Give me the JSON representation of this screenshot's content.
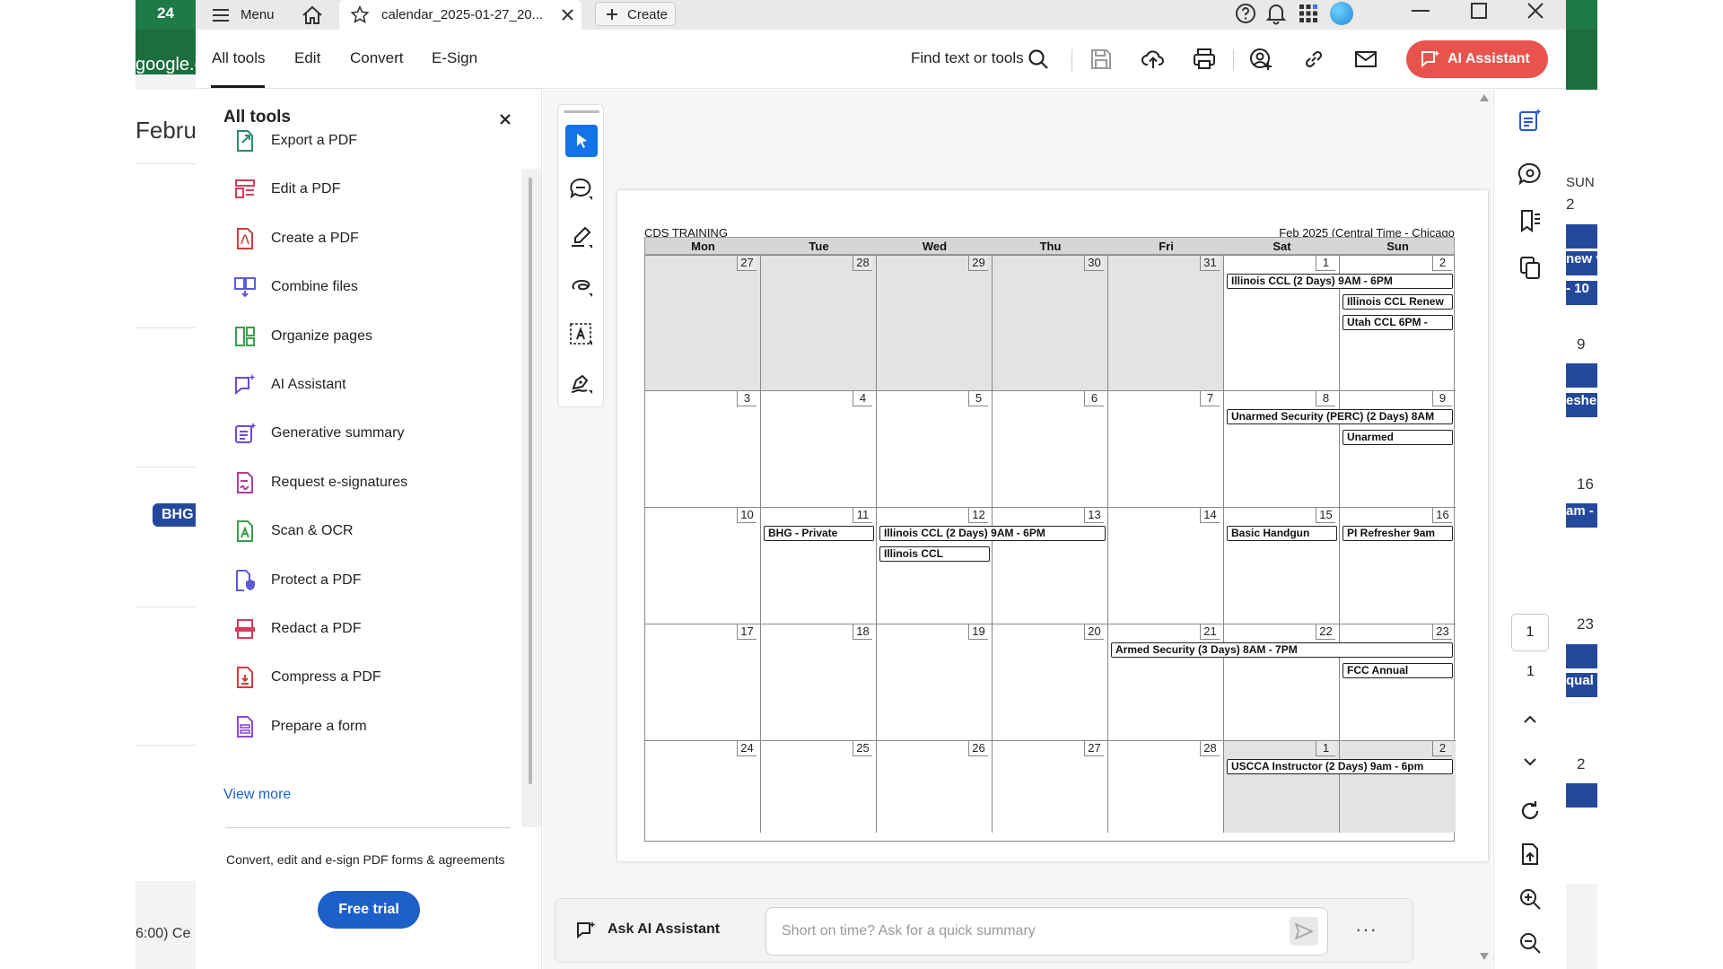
{
  "background": {
    "left_badge": "24",
    "left_domain": "google.c",
    "left_month": "Februa",
    "left_event": "BHG",
    "left_timezone": "6:00) Ce",
    "right_day_label": "SUN",
    "right_numbers": [
      "2",
      "9",
      "16",
      "23",
      "2"
    ],
    "right_events": [
      "new v",
      "- 10",
      "esher",
      "am -",
      "qual"
    ]
  },
  "titlebar": {
    "menu_label": "Menu",
    "tab_title": "calendar_2025-01-27_20...",
    "create_label": "Create"
  },
  "toolbar": {
    "tabs": [
      "All tools",
      "Edit",
      "Convert",
      "E-Sign"
    ],
    "search_label": "Find text or tools",
    "ai_assistant_label": "AI Assistant"
  },
  "sidebar": {
    "title": "All tools",
    "items": [
      {
        "label": "Export a PDF",
        "icon": "export-pdf-icon",
        "color": "#2e8b6e"
      },
      {
        "label": "Edit a PDF",
        "icon": "edit-pdf-icon",
        "color": "#d53c5c"
      },
      {
        "label": "Create a PDF",
        "icon": "create-pdf-icon",
        "color": "#d53c3c"
      },
      {
        "label": "Combine files",
        "icon": "combine-files-icon",
        "color": "#5b5bd6"
      },
      {
        "label": "Organize pages",
        "icon": "organize-pages-icon",
        "color": "#3aa04a"
      },
      {
        "label": "AI Assistant",
        "icon": "ai-assistant-icon",
        "color": "#6c4ad6"
      },
      {
        "label": "Generative summary",
        "icon": "generative-summary-icon",
        "color": "#6c4ad6"
      },
      {
        "label": "Request e-signatures",
        "icon": "request-esignatures-icon",
        "color": "#b0409a"
      },
      {
        "label": "Scan & OCR",
        "icon": "scan-ocr-icon",
        "color": "#3aa04a"
      },
      {
        "label": "Protect a PDF",
        "icon": "protect-pdf-icon",
        "color": "#5b5bd6"
      },
      {
        "label": "Redact a PDF",
        "icon": "redact-pdf-icon",
        "color": "#d53c5c"
      },
      {
        "label": "Compress a PDF",
        "icon": "compress-pdf-icon",
        "color": "#d53c3c"
      },
      {
        "label": "Prepare a form",
        "icon": "prepare-form-icon",
        "color": "#8b4ad6"
      }
    ],
    "view_more": "View more",
    "promo_text": "Convert, edit and e-sign PDF forms & agreements",
    "free_trial": "Free trial"
  },
  "calendar": {
    "title": "CDS TRAINING",
    "subtitle": "Feb 2025 (Central Time - Chicago",
    "days": [
      "Mon",
      "Tue",
      "Wed",
      "Thu",
      "Fri",
      "Sat",
      "Sun"
    ],
    "weeks": [
      {
        "dates": [
          "27",
          "28",
          "29",
          "30",
          "31",
          "1",
          "2"
        ],
        "gray": [
          true,
          true,
          true,
          true,
          true,
          false,
          false
        ]
      },
      {
        "dates": [
          "3",
          "4",
          "5",
          "6",
          "7",
          "8",
          "9"
        ],
        "gray": [
          false,
          false,
          false,
          false,
          false,
          false,
          false
        ]
      },
      {
        "dates": [
          "10",
          "11",
          "12",
          "13",
          "14",
          "15",
          "16"
        ],
        "gray": [
          false,
          false,
          false,
          false,
          false,
          false,
          false
        ]
      },
      {
        "dates": [
          "17",
          "18",
          "19",
          "20",
          "21",
          "22",
          "23"
        ],
        "gray": [
          false,
          false,
          false,
          false,
          false,
          false,
          false
        ]
      },
      {
        "dates": [
          "24",
          "25",
          "26",
          "27",
          "28",
          "1",
          "2"
        ],
        "gray": [
          false,
          false,
          false,
          false,
          false,
          true,
          true
        ]
      }
    ],
    "events": [
      {
        "week": 0,
        "col": 5,
        "span": 2,
        "row": 0,
        "label": "Illinois CCL (2 Days) 9AM - 6PM"
      },
      {
        "week": 0,
        "col": 6,
        "span": 1,
        "row": 1,
        "label": "Illinois CCL Renew"
      },
      {
        "week": 0,
        "col": 6,
        "span": 1,
        "row": 2,
        "label": "Utah CCL 6PM -"
      },
      {
        "week": 1,
        "col": 5,
        "span": 2,
        "row": 0,
        "label": "Unarmed Security (PERC) (2 Days) 8AM"
      },
      {
        "week": 1,
        "col": 6,
        "span": 1,
        "row": 1,
        "label": "Unarmed"
      },
      {
        "week": 2,
        "col": 1,
        "span": 1,
        "row": 0,
        "label": "BHG - Private"
      },
      {
        "week": 2,
        "col": 2,
        "span": 2,
        "row": 0,
        "label": "Illinois CCL (2 Days) 9AM - 6PM"
      },
      {
        "week": 2,
        "col": 2,
        "span": 1,
        "row": 1,
        "label": "Illinois CCL"
      },
      {
        "week": 2,
        "col": 5,
        "span": 1,
        "row": 0,
        "label": "Basic Handgun"
      },
      {
        "week": 2,
        "col": 6,
        "span": 1,
        "row": 0,
        "label": "PI Refresher 9am"
      },
      {
        "week": 3,
        "col": 4,
        "span": 3,
        "row": 0,
        "label": "Armed Security (3 Days) 8AM - 7PM"
      },
      {
        "week": 3,
        "col": 6,
        "span": 1,
        "row": 1,
        "label": "FCC Annual"
      },
      {
        "week": 4,
        "col": 5,
        "span": 2,
        "row": 0,
        "label": "USCCA Instructor (2 Days) 9am - 6pm"
      }
    ]
  },
  "ask_ai": {
    "label": "Ask AI Assistant",
    "placeholder": "Short on time? Ask for a quick summary",
    "more": "···"
  },
  "rail": {
    "current_page": "1",
    "total_pages": "1"
  },
  "colors": {
    "accent_red": "#e8534d",
    "accent_blue": "#1d5fc9",
    "selected_tool": "#1473e6",
    "gcal_blue": "#24499c",
    "gcal_green": "#1e7a46"
  }
}
